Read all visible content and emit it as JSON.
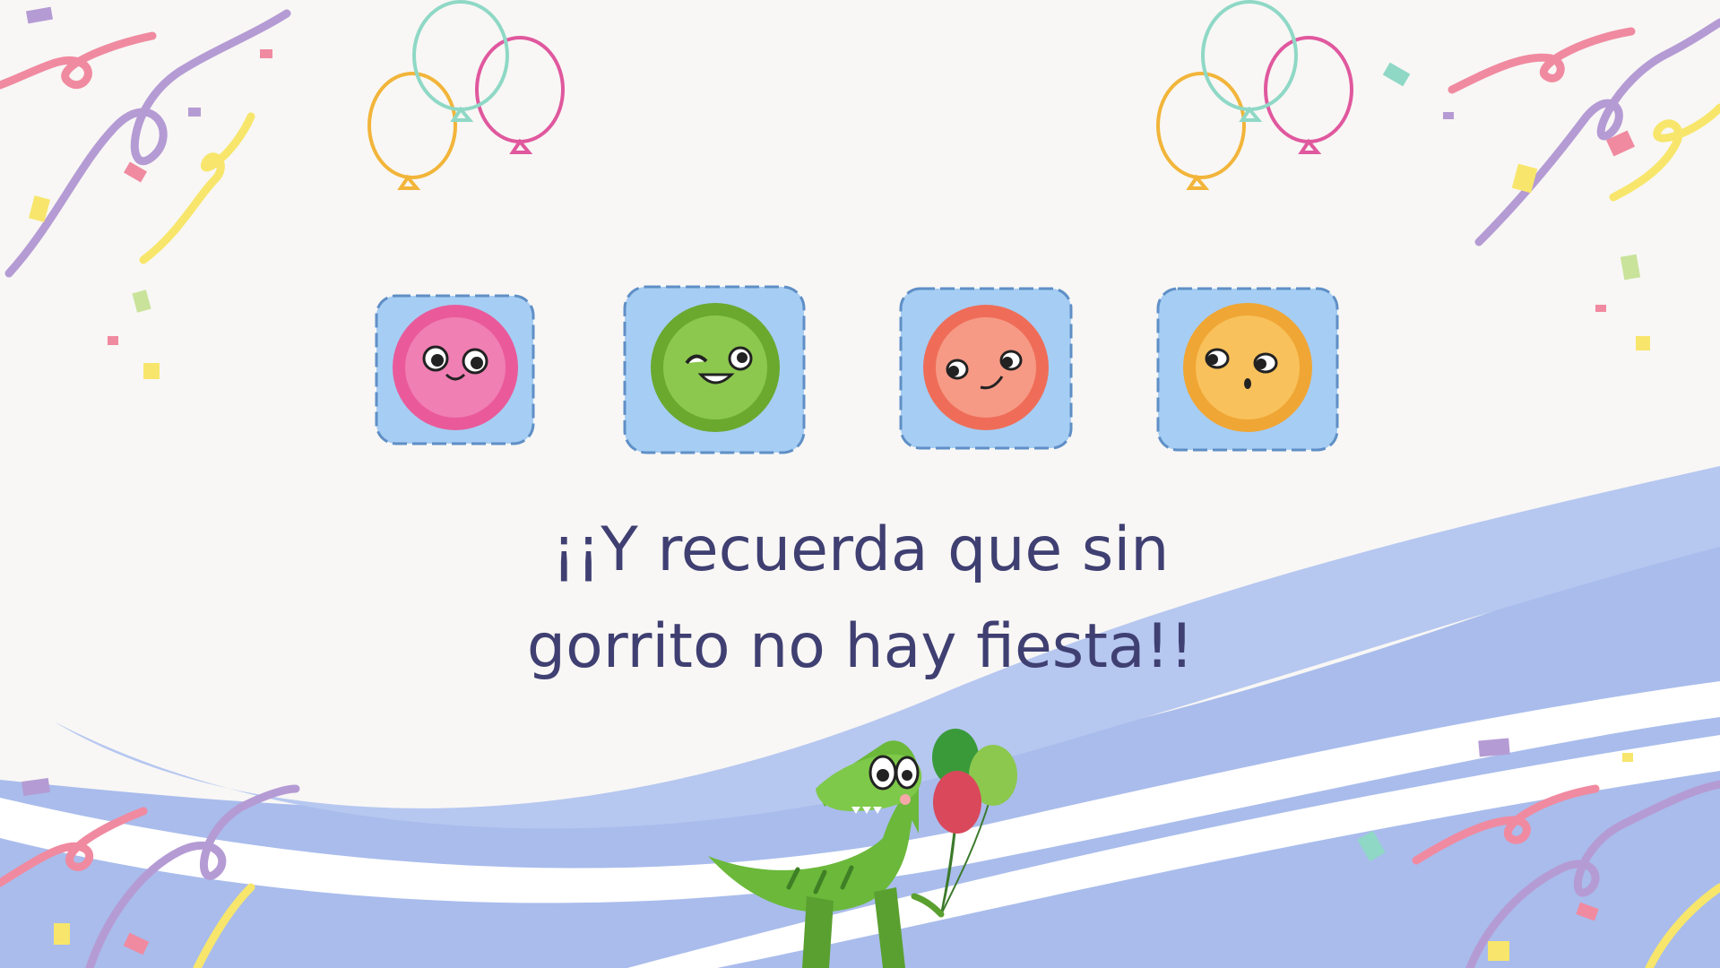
{
  "slide": {
    "message_line_1": "¡¡Y recuerda que sin",
    "message_line_2": "gorrito no hay fiesta!!"
  },
  "faces": [
    {
      "name": "pink-smiling-face",
      "color": "#ea5a9a"
    },
    {
      "name": "green-grinning-face",
      "color": "#7fbf3f"
    },
    {
      "name": "coral-smirking-face",
      "color": "#f47f6c"
    },
    {
      "name": "orange-sideeye-face",
      "color": "#f4b14a"
    }
  ],
  "colors": {
    "background": "#f8f7f5",
    "text": "#3f3f72",
    "wave": "#a9bcec",
    "icon_backdrop": "#a6cdf3",
    "balloon_teal": "#8fd8c6",
    "balloon_orange": "#f2b53a",
    "balloon_pink": "#e0589e",
    "dino_green": "#6bb83a"
  },
  "icons": [
    "balloons-icon",
    "confetti-icon",
    "dinosaur-icon",
    "streamer-icon"
  ]
}
